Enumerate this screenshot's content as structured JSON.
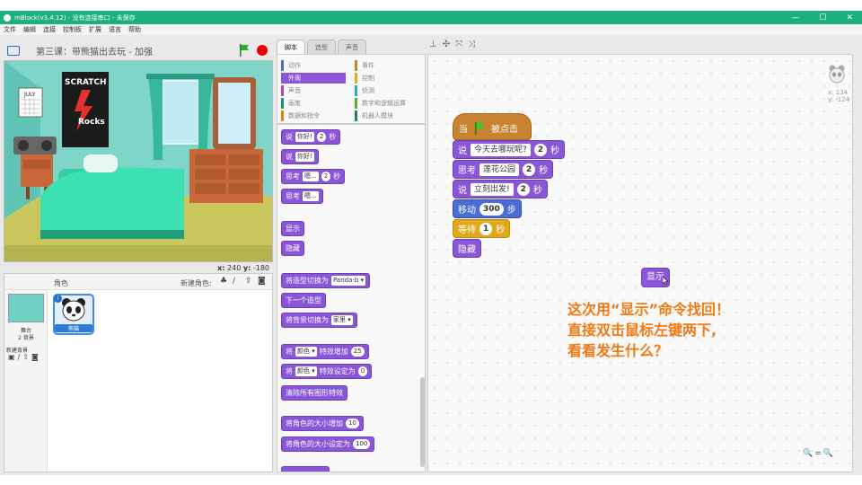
{
  "window": {
    "title": "mBlock(v3.4.12) - 没有连接串口 - 未保存",
    "minimize": "—",
    "maximize": "☐",
    "close": "✕"
  },
  "menu": [
    "文件",
    "编辑",
    "连接",
    "控制板",
    "扩展",
    "语言",
    "帮助"
  ],
  "stage": {
    "title": "第三课：带熊猫出去玩 - 加强",
    "x_label": "x:",
    "x_value": "240",
    "y_label": "y:",
    "y_value": "-180",
    "poster_line1": "SCRATCH",
    "poster_line2": "Rocks",
    "calendar": "JULY"
  },
  "sprites": {
    "header": "角色",
    "new_sprite": "新建角色:",
    "stage_label": "舞台",
    "backdrop_count": "2 背景",
    "new_backdrop": "新建背景",
    "sprite_name": "熊猫",
    "info": "i"
  },
  "tabs": [
    "脚本",
    "造型",
    "声音"
  ],
  "categories": [
    {
      "label": "动作",
      "color": "#4a6cd4"
    },
    {
      "label": "事件",
      "color": "#c88330"
    },
    {
      "label": "外观",
      "color": "#8a55d7"
    },
    {
      "label": "控制",
      "color": "#e1a91a"
    },
    {
      "label": "声音",
      "color": "#bb42c3"
    },
    {
      "label": "侦测",
      "color": "#2ca5e2"
    },
    {
      "label": "画笔",
      "color": "#0e9a6c"
    },
    {
      "label": "数字和逻辑运算",
      "color": "#5cb712"
    },
    {
      "label": "数据和指令",
      "color": "#ee7d16"
    },
    {
      "label": "机器人模块",
      "color": "#17807a"
    }
  ],
  "palette": {
    "say_secs": {
      "label": "说",
      "text": "你好!",
      "secs": "2",
      "unit": "秒"
    },
    "say": {
      "label": "说",
      "text": "你好!"
    },
    "think_secs": {
      "label": "思考",
      "text": "嗯...",
      "secs": "2",
      "unit": "秒"
    },
    "think": {
      "label": "思考",
      "text": "嗯..."
    },
    "show": "显示",
    "hide": "隐藏",
    "switch_costume": {
      "label": "将造型切换为",
      "value": "Panda-b"
    },
    "next_costume": "下一个造型",
    "switch_backdrop": {
      "label": "将背景切换为",
      "value": "家里"
    },
    "change_effect": {
      "prefix": "将",
      "effect": "颜色",
      "label": "特效增加",
      "value": "25"
    },
    "set_effect": {
      "prefix": "将",
      "effect": "颜色",
      "label": "特效设定为",
      "value": "0"
    },
    "clear_effects": "清除所有图形特效",
    "change_size": {
      "label": "将角色的大小增加",
      "value": "10"
    },
    "set_size": {
      "label": "将角色的大小设定为",
      "value": "100"
    }
  },
  "script": {
    "hat": {
      "prefix": "当",
      "suffix": "被点击"
    },
    "say1": {
      "label": "说",
      "text": "今天去哪玩呢?",
      "secs": "2",
      "unit": "秒"
    },
    "think1": {
      "label": "思考",
      "text": "莲花公园",
      "secs": "2",
      "unit": "秒"
    },
    "say2": {
      "label": "说",
      "text": "立刻出发!",
      "secs": "2",
      "unit": "秒"
    },
    "move": {
      "label": "移动",
      "value": "300",
      "unit": "步"
    },
    "wait": {
      "label": "等待",
      "value": "1",
      "unit": "秒"
    },
    "hide": "隐藏",
    "floating_show": "显示"
  },
  "note": [
    "这次用“显示”命令找回！",
    "直接双击鼠标左键两下,",
    "看看发生什么？"
  ],
  "sprite_info": {
    "x": "x: 134",
    "y": "y: -124"
  },
  "zoom": {
    "out": "🔍",
    "reset": "=",
    "in": "🔍"
  }
}
